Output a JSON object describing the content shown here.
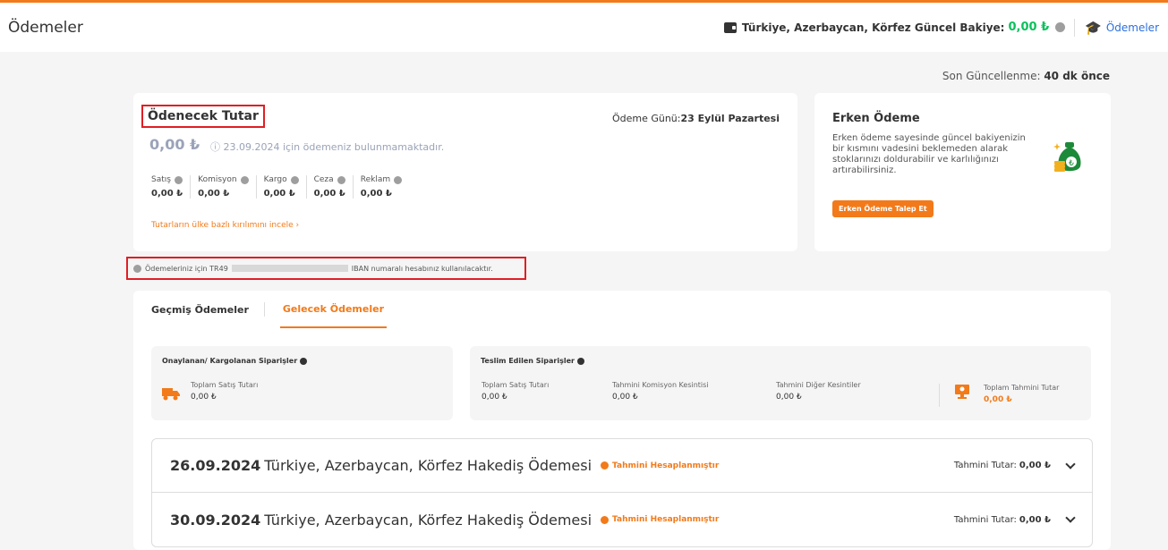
{
  "header": {
    "title": "Ödemeler",
    "balance_label": "Türkiye, Azerbaycan, Körfez Güncel Bakiye:",
    "balance_value": "0,00 ₺",
    "payments_link": "Ödemeler"
  },
  "updated": {
    "label": "Son Güncellenme:",
    "value": "40 dk önce"
  },
  "payment_card": {
    "title": "Ödenecek Tutar",
    "date_label": "Ödeme Günü:",
    "date_value": "23 Eylül Pazartesi",
    "amount": "0,00 ₺",
    "note": "ⓘ 23.09.2024 için ödemeniz bulunmamaktadır.",
    "breakdown": [
      {
        "label": "Satış",
        "value": "0,00 ₺"
      },
      {
        "label": "Komisyon",
        "value": "0,00 ₺"
      },
      {
        "label": "Kargo",
        "value": "0,00 ₺"
      },
      {
        "label": "Ceza",
        "value": "0,00 ₺"
      },
      {
        "label": "Reklam",
        "value": "0,00 ₺"
      }
    ],
    "country_link": "Tutarların ülke bazlı kırılımını incele ›"
  },
  "early_card": {
    "title": "Erken Ödeme",
    "description": "Erken ödeme sayesinde güncel bakiyenizin bir kısmını vadesini beklemeden alarak stoklarınızı doldurabilir ve karlılığınızı artırabilirsiniz.",
    "button": "Erken Ödeme Talep Et"
  },
  "iban": {
    "prefix": "Ödemeleriniz için TR49",
    "suffix": "IBAN numaralı hesabınız kullanılacaktır."
  },
  "tabs": [
    {
      "label": "Geçmiş Ödemeler",
      "active": false
    },
    {
      "label": "Gelecek Ödemeler",
      "active": true
    }
  ],
  "summary": {
    "confirmed": {
      "title": "Onaylanan/ Kargolanan Siparişler",
      "items": [
        {
          "label": "Toplam Satış Tutarı",
          "value": "0,00 ₺"
        }
      ]
    },
    "delivered": {
      "title": "Teslim Edilen Siparişler",
      "items": [
        {
          "label": "Toplam Satış Tutarı",
          "value": "0,00 ₺"
        },
        {
          "label": "Tahmini Komisyon Kesintisi",
          "value": "0,00 ₺"
        },
        {
          "label": "Tahmini Diğer Kesintiler",
          "value": "0,00 ₺"
        }
      ],
      "total_label": "Toplam Tahmini Tutar",
      "total_value": "0,00 ₺"
    }
  },
  "payments": [
    {
      "date": "26.09.2024",
      "title": "Türkiye, Azerbaycan, Körfez Hakediş Ödemesi",
      "status": "Tahmini Hesaplanmıştır",
      "amount_label": "Tahmini Tutar:",
      "amount": "0,00 ₺"
    },
    {
      "date": "30.09.2024",
      "title": "Türkiye, Azerbaycan, Körfez Hakediş Ödemesi",
      "status": "Tahmini Hesaplanmıştır",
      "amount_label": "Tahmini Tutar:",
      "amount": "0,00 ₺"
    }
  ],
  "colors": {
    "accent": "#f27a1a",
    "success": "#0bc15c",
    "link": "#2b6fe0",
    "highlight": "#e01e25"
  }
}
